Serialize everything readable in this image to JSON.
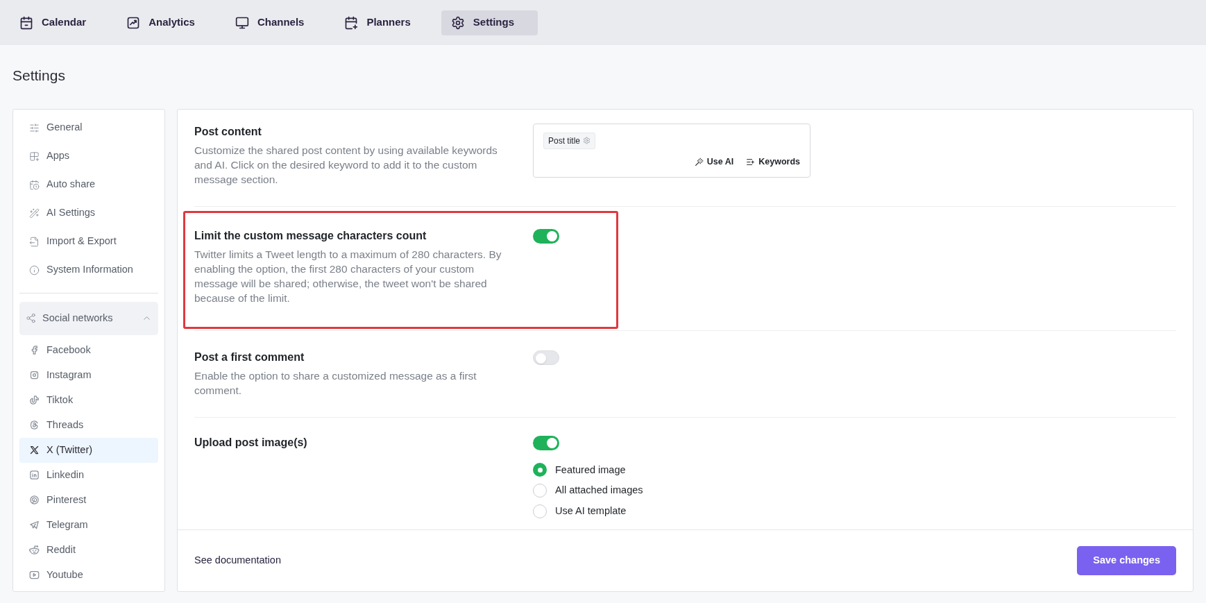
{
  "nav": [
    {
      "label": "Calendar",
      "selected": false
    },
    {
      "label": "Analytics",
      "selected": false
    },
    {
      "label": "Channels",
      "selected": false
    },
    {
      "label": "Planners",
      "selected": false
    },
    {
      "label": "Settings",
      "selected": true
    }
  ],
  "page_title": "Settings",
  "sidebar": {
    "items": [
      {
        "label": "General",
        "selected": false
      },
      {
        "label": "Apps",
        "selected": false
      },
      {
        "label": "Auto share",
        "selected": false
      },
      {
        "label": "AI Settings",
        "selected": false
      },
      {
        "label": "Import & Export",
        "selected": false
      },
      {
        "label": "System Information",
        "selected": false
      }
    ],
    "social_networks": {
      "label": "Social networks",
      "expanded": true,
      "items": [
        {
          "label": "Facebook",
          "selected": false
        },
        {
          "label": "Instagram",
          "selected": false
        },
        {
          "label": "Tiktok",
          "selected": false
        },
        {
          "label": "Threads",
          "selected": false
        },
        {
          "label": "X (Twitter)",
          "selected": true
        },
        {
          "label": "Linkedin",
          "selected": false
        },
        {
          "label": "Pinterest",
          "selected": false
        },
        {
          "label": "Telegram",
          "selected": false
        },
        {
          "label": "Reddit",
          "selected": false
        },
        {
          "label": "Youtube",
          "selected": false
        }
      ]
    }
  },
  "sections": [
    {
      "kind": "keywords",
      "title": "Post content",
      "description": "Customize the shared post content by using available keywords and AI. Click on the desired keyword to add it to the custom message section.",
      "chip": "Post title",
      "actions": [
        "Use AI",
        "Keywords"
      ],
      "highlighted": false
    },
    {
      "kind": "toggle",
      "title": "Limit the custom message characters count",
      "description": "Twitter limits a Tweet length to a maximum of 280 characters. By enabling the option, the first 280 characters of your custom message will be shared; otherwise, the tweet won't be shared because of the limit.",
      "on": true,
      "highlighted": true
    },
    {
      "kind": "toggle",
      "title": "Post a first comment",
      "description": "Enable the option to share a customized message as a first comment.",
      "on": false,
      "highlighted": false
    },
    {
      "kind": "toggle_options",
      "title": "Upload post image(s)",
      "on": true,
      "highlighted": false,
      "options": [
        {
          "label": "Featured image",
          "selected": true
        },
        {
          "label": "All attached images",
          "selected": false
        },
        {
          "label": "Use AI template",
          "selected": false
        }
      ]
    }
  ],
  "footer": {
    "link": "See documentation",
    "button": "Save changes"
  }
}
